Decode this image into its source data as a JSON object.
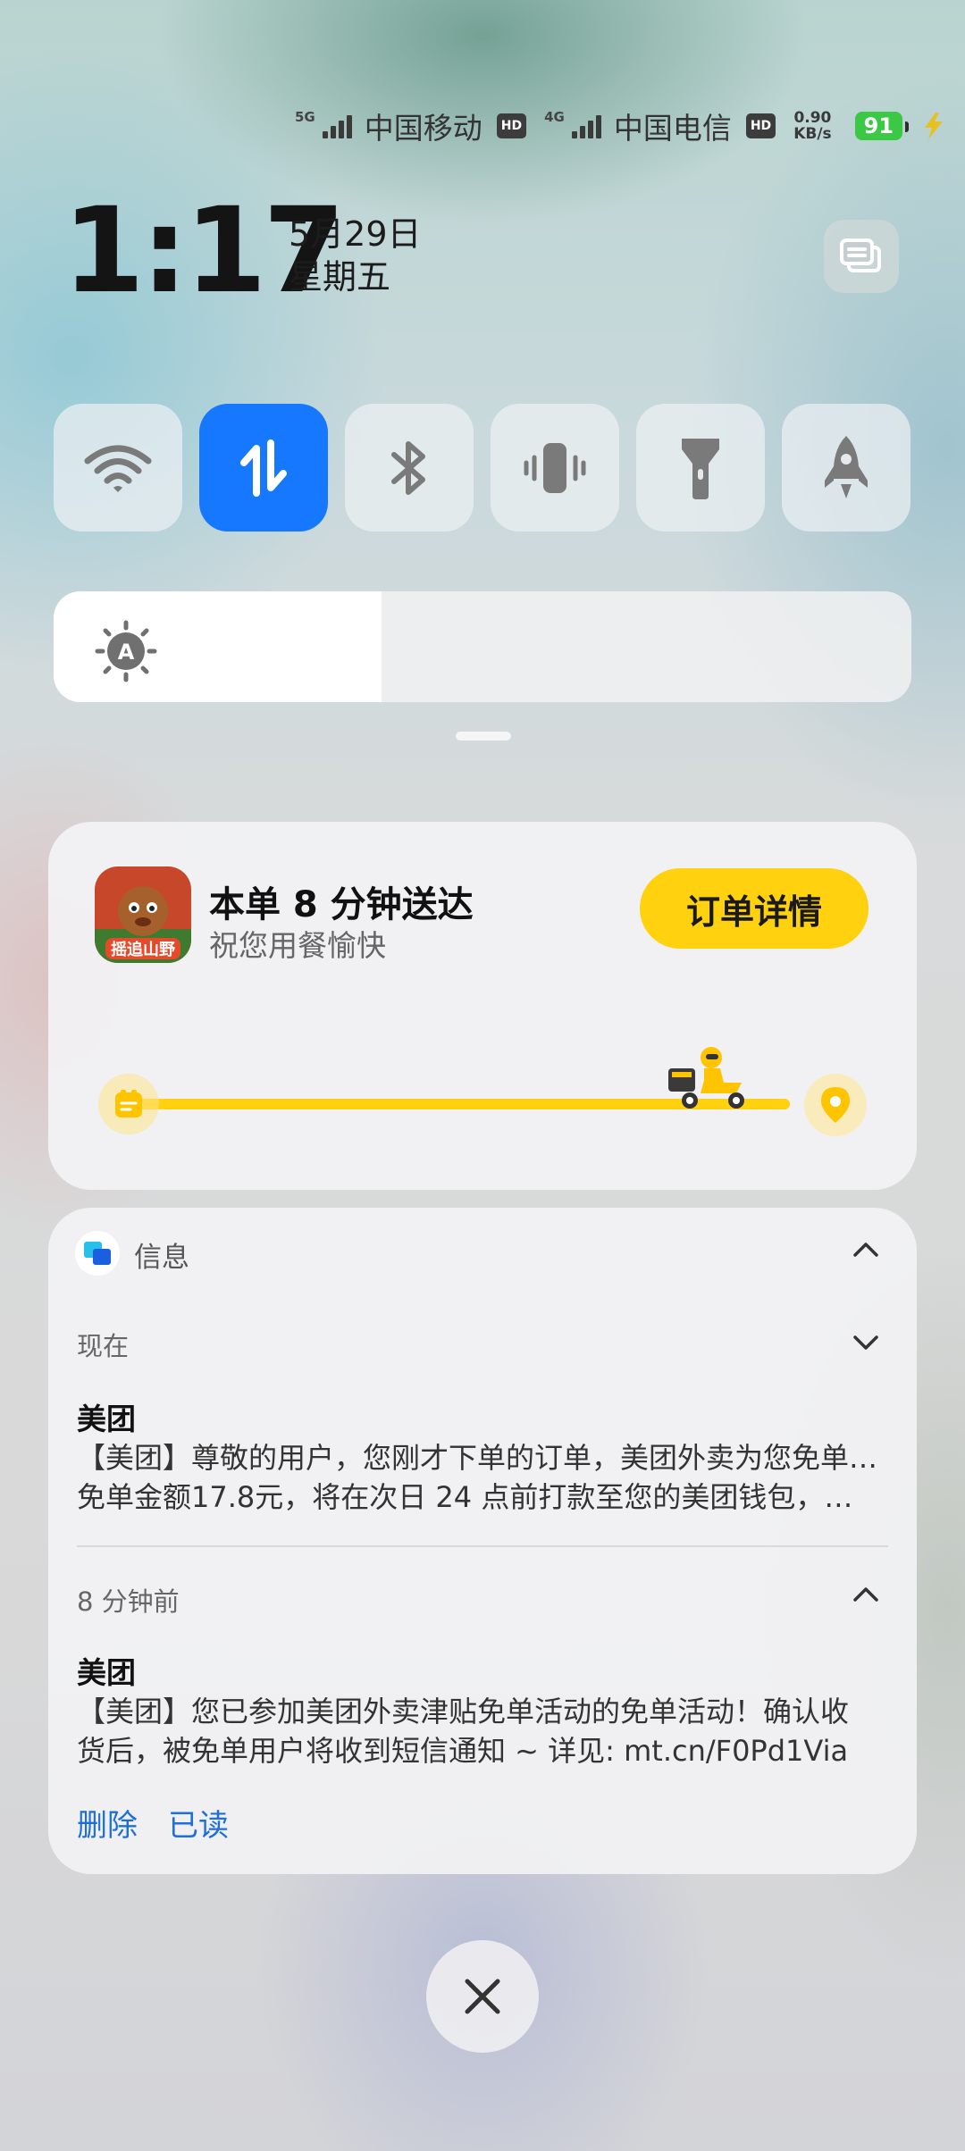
{
  "status_bar": {
    "sim1": {
      "network": "5G",
      "carrier": "中国移动",
      "hd": "HD"
    },
    "sim2": {
      "network": "4G",
      "carrier": "中国电信",
      "hd": "HD"
    },
    "speed_value": "0.90",
    "speed_unit": "KB/s",
    "battery": "91"
  },
  "clock": {
    "time": "1:17",
    "date": "5月29日",
    "weekday": "星期五"
  },
  "quick_tiles": [
    {
      "name": "wifi",
      "icon": "wifi-icon",
      "active": false
    },
    {
      "name": "mobile-data",
      "icon": "data-transfer-icon",
      "active": true
    },
    {
      "name": "bluetooth",
      "icon": "bluetooth-icon",
      "active": false
    },
    {
      "name": "vibrate",
      "icon": "vibrate-icon",
      "active": false
    },
    {
      "name": "flashlight",
      "icon": "flashlight-icon",
      "active": false
    },
    {
      "name": "boost",
      "icon": "rocket-icon",
      "active": false
    }
  ],
  "brightness": {
    "level": 0.25,
    "mode": "A"
  },
  "delivery": {
    "app_icon_text": "摇追山野",
    "title": "本单 8 分钟送达",
    "subtitle": "祝您用餐愉快",
    "button": "订单详情",
    "progress": 0.93,
    "accent": "#FFD10F"
  },
  "messages": {
    "app_name": "信息",
    "groups": [
      {
        "time": "现在",
        "sender": "美团",
        "line1": "【美团】尊敬的用户，您刚才下单的订单，美团外卖为您免单啦！",
        "line2": "免单金额17.8元，将在次日 24 点前打款至您的美团钱包，…"
      },
      {
        "time": "8 分钟前",
        "sender": "美团",
        "line1": "【美团】您已参加美团外卖津贴免单活动的免单活动！确认收",
        "line2": "货后，被免单用户将收到短信通知 ~ 详见: mt.cn/F0Pd1Via"
      }
    ],
    "actions": {
      "delete": "删除",
      "read": "已读"
    },
    "link_color": "#1E6FD9"
  },
  "tile_active_color": "#1677FF"
}
